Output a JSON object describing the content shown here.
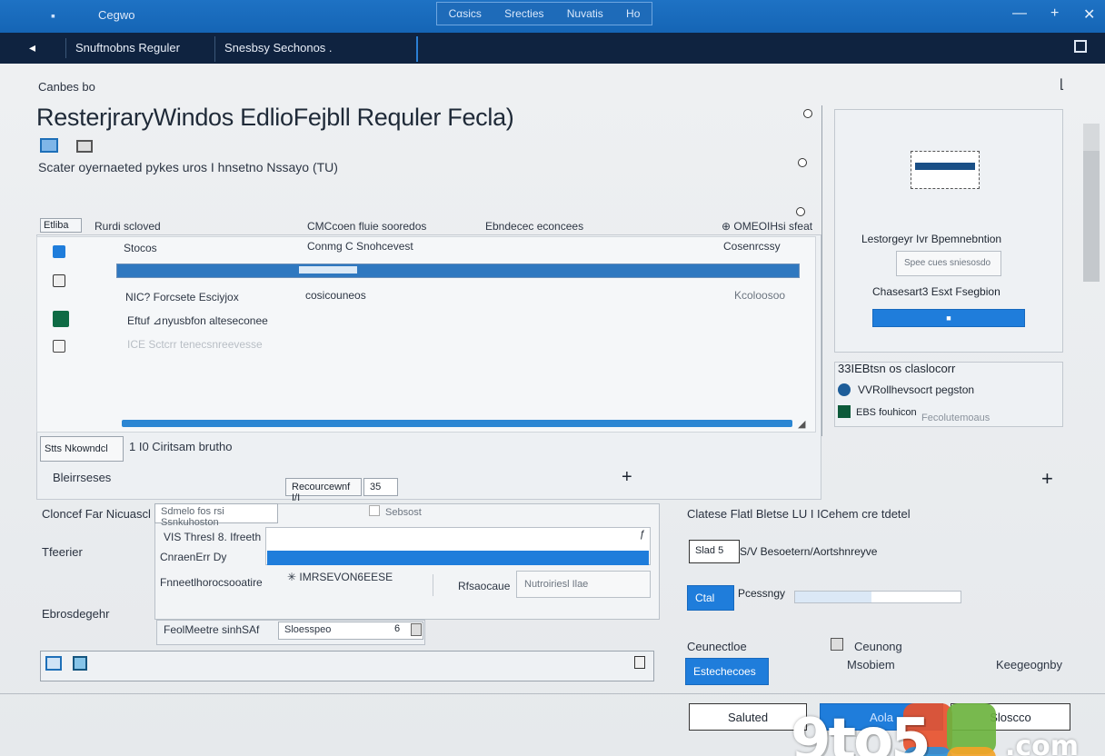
{
  "window": {
    "title": "Cegwo",
    "center_tabs": [
      "Cαsics",
      "Srecties",
      "Nuvatis",
      "Ho"
    ],
    "controls": [
      "—",
      "+",
      "✕"
    ]
  },
  "nav": {
    "back_glyph": "◂",
    "crumb_1": "Snuftnobns Reguler",
    "crumb_2": "Snesbsy Sechonos ."
  },
  "header": {
    "section_label": "Canbes bo",
    "page_title": "ResterjraryWindos EdlioFejbll Requler Fecla)",
    "subtitle": "Scater oyernaeted pykes uros I hnsetno Nssayo (TU)"
  },
  "table": {
    "columns": [
      "Rurdi scloved",
      "CMCcoen fluie sooredos",
      "Ebndecec econcees",
      "⊕ OMEOIHsi sfeat"
    ],
    "corner_label": "Etliba",
    "rows": [
      {
        "name": "Stocos",
        "type": "Conmg C Snohcevest",
        "extra": "",
        "status": "Cosenrcssy"
      },
      {
        "name": "",
        "type": "",
        "extra": "",
        "status": ""
      },
      {
        "name": "NIC? Forcsete Esciyjox",
        "type": "cosicouneos",
        "extra": "",
        "status": "Kcoloosoo"
      },
      {
        "name": "Eftuf ⊿nyusbfon alteseconee",
        "type": "",
        "extra": "",
        "status": ""
      },
      {
        "name": "ICE Sctcrr tenecsnreevesse",
        "type": "",
        "extra": "",
        "status": ""
      }
    ],
    "footer_tab": "Stts Nkowndcl",
    "footer_count": "1 I0 Ciritsam brutho"
  },
  "side_card": {
    "heading": "Lestorgeyr Ivr Bpemnebntion",
    "placeholder": "Spee cues sniesosdo",
    "label": "Chasesart3 Esxt Fsegbion",
    "button": "■"
  },
  "side_card2": {
    "title": "33IEBtsn os claslocorr",
    "item1": "VVRollhevsocrt pegston",
    "item2_a": "EBS fouhicon",
    "item2_b": "Fecolutemoaus"
  },
  "lower": {
    "section": "Bleirrseses",
    "resources_btn": "Recourcewnf I/I",
    "resources_count": "35",
    "channel_label": "Cloncef Far Nicuascl",
    "channel_placeholder": "Sdmelo fos rsi Ssnkuhoston",
    "channel_right": "Sebsost",
    "theme_label": "Tfeerier",
    "list_1": "VIS  ThresI 8. Ifreeth",
    "list_2": "CnraenErr Dy",
    "list_3": "Fnneetlhorocsooatire",
    "list_code": "✳ IMRSEVON6EESE",
    "list_mid": "Rfsaocaue",
    "list_right": "Nutroiriesl Ilae",
    "ensure_label": "Ebrosdegehr",
    "ensure_value": "FeolMeetre sinhSAf",
    "ensure_field": "Sloesspeo",
    "ensure_num": "6"
  },
  "right_lower": {
    "heading": "Clatese Flatl Bletse LU I ICehem cre tdetel",
    "key_label": "Slad 5",
    "key_desc": "S/V Besoetern/Aortshnreyve",
    "btn_blue": "Ctal",
    "btn_label": "Pcessngy",
    "section2": "Ceunectloe",
    "opt1": "Ceunong",
    "opt2": "Msobiem",
    "opt3": "Keegeognby",
    "action_btn": "Estechecoes"
  },
  "footer": {
    "secondary": "Saluted",
    "primary": "Aola",
    "cancel": "Sloscco"
  },
  "watermark": {
    "text": "9to5",
    "suffix": ".com"
  }
}
